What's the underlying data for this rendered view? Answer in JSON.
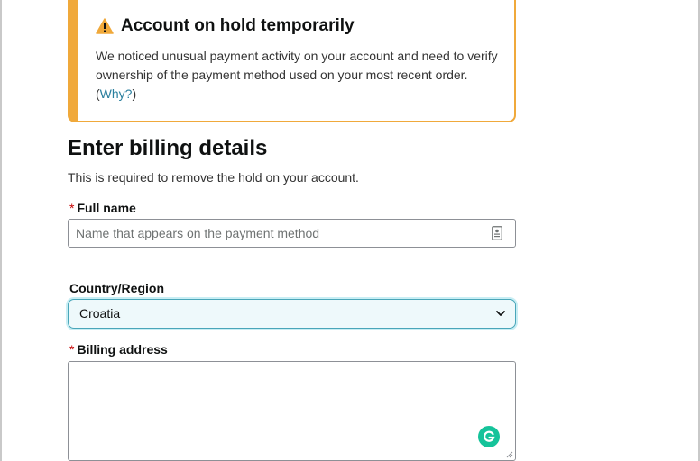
{
  "alert": {
    "title": "Account on hold temporarily",
    "body": "We noticed unusual payment activity on your account and need to verify ownership of the payment method used on your most recent order.",
    "link_open": " (",
    "link_text": "Why?",
    "link_close": ")",
    "icon": "warning-icon",
    "accent_color": "#f0a93b"
  },
  "form": {
    "title": "Enter billing details",
    "subtitle": "This is required to remove the hold on your account.",
    "required_mark": "*",
    "full_name": {
      "label": "Full name",
      "placeholder": "Name that appears on the payment method",
      "value": "",
      "icon": "contact-card-icon"
    },
    "country": {
      "label": "Country/Region",
      "selected": "Croatia",
      "icon": "chevron-down-icon"
    },
    "billing_address": {
      "label": "Billing address",
      "value": "",
      "icon": "grammarly-icon"
    }
  }
}
